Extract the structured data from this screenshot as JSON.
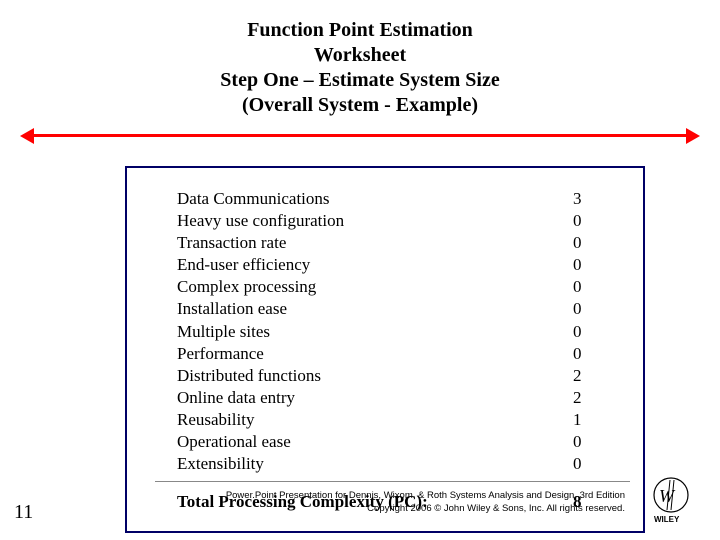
{
  "title": {
    "line1": "Function Point Estimation",
    "line2": "Worksheet",
    "line3": "Step One – Estimate System Size",
    "line4": "(Overall System - Example)"
  },
  "rows": [
    {
      "label": "Data Communications",
      "value": "3"
    },
    {
      "label": "Heavy use configuration",
      "value": "0"
    },
    {
      "label": "Transaction rate",
      "value": "0"
    },
    {
      "label": "End-user efficiency",
      "value": "0"
    },
    {
      "label": "Complex processing",
      "value": "0"
    },
    {
      "label": "Installation ease",
      "value": "0"
    },
    {
      "label": "Multiple sites",
      "value": "0"
    },
    {
      "label": "Performance",
      "value": "0"
    },
    {
      "label": "Distributed functions",
      "value": "2"
    },
    {
      "label": "Online data entry",
      "value": "2"
    },
    {
      "label": "Reusability",
      "value": "1"
    },
    {
      "label": "Operational ease",
      "value": "0"
    },
    {
      "label": "Extensibility",
      "value": "0"
    }
  ],
  "total": {
    "label": "Total Processing Complexity (PC):",
    "value": "8"
  },
  "footer": {
    "line1": "Power.Point Presentation for Dennis, Wixom, & Roth Systems Analysis and Design, 3rd Edition",
    "line2": "Copyright 2006 © John Wiley & Sons, Inc.  All rights reserved."
  },
  "slide_number": "11",
  "chart_data": {
    "type": "table",
    "title": "Function Point Estimation Worksheet — Step One (Overall System Example)",
    "categories": [
      "Data Communications",
      "Heavy use configuration",
      "Transaction rate",
      "End-user efficiency",
      "Complex processing",
      "Installation ease",
      "Multiple sites",
      "Performance",
      "Distributed functions",
      "Online data entry",
      "Reusability",
      "Operational ease",
      "Extensibility"
    ],
    "values": [
      3,
      0,
      0,
      0,
      0,
      0,
      0,
      0,
      2,
      2,
      1,
      0,
      0
    ],
    "total_label": "Total Processing Complexity (PC):",
    "total_value": 8
  }
}
